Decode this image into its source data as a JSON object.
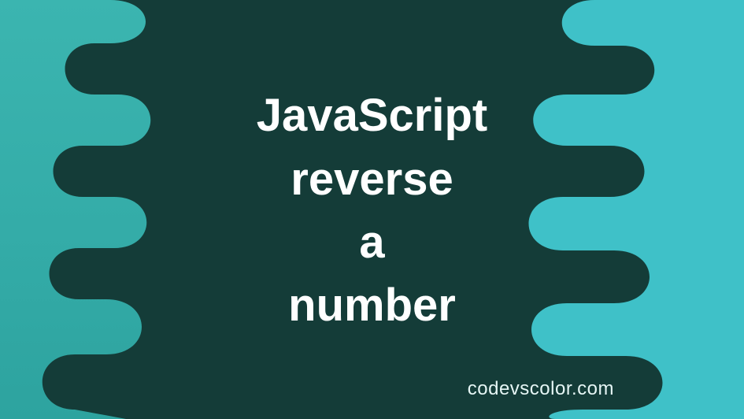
{
  "title": {
    "line1": "JavaScript",
    "line2": "reverse",
    "line3": "a",
    "line4": "number"
  },
  "watermark": "codevscolor.com",
  "colors": {
    "background_dark": "#143c38",
    "teal_left_top": "#37b0ac",
    "teal_left_bottom": "#2fa7a5",
    "teal_right": "#3fc1c8",
    "text": "#ffffff"
  }
}
